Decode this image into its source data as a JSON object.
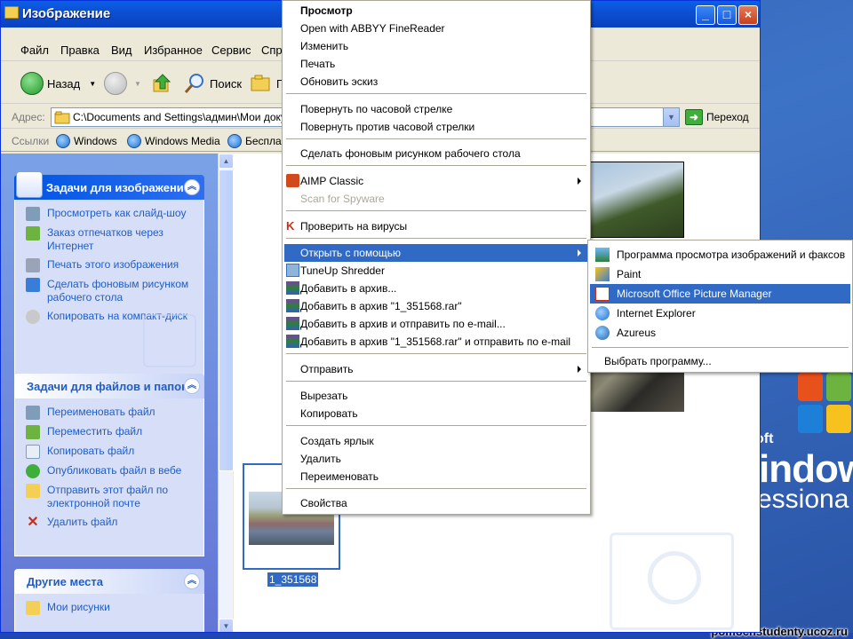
{
  "window": {
    "title": "Изображение",
    "menu": [
      "Файл",
      "Правка",
      "Вид",
      "Избранное",
      "Сервис",
      "Спра"
    ],
    "toolbar": {
      "back": "Назад",
      "search": "Поиск",
      "folders": "П"
    },
    "address": {
      "label": "Адрес:",
      "value": "C:\\Documents and Settings\\админ\\Мои доку",
      "go": "Переход"
    },
    "links": {
      "label": "Ссылки",
      "items": [
        "Windows",
        "Windows Media",
        "Беспла"
      ]
    }
  },
  "leftpane": {
    "image_tasks": {
      "title": "Задачи для изображени",
      "items": [
        "Просмотреть как слайд-шоу",
        "Заказ отпечатков через Интернет",
        "Печать этого изображения",
        "Сделать фоновым рисунком рабочего стола",
        "Копировать на компакт-диск"
      ]
    },
    "file_tasks": {
      "title": "Задачи для файлов и папок",
      "items": [
        "Переименовать файл",
        "Переместить файл",
        "Копировать файл",
        "Опубликовать файл в вебе",
        "Отправить этот файл по электронной почте",
        "Удалить файл"
      ]
    },
    "other_places": {
      "title": "Другие места",
      "items": [
        "Мои рисунки"
      ]
    }
  },
  "content": {
    "selected_file": "1_351568"
  },
  "context_menu": {
    "items": [
      {
        "label": "Просмотр",
        "bold": true
      },
      {
        "label": "Open with ABBYY FineReader"
      },
      {
        "label": "Изменить"
      },
      {
        "label": "Печать"
      },
      {
        "label": "Обновить эскиз"
      },
      {
        "label": "Повернуть по часовой стрелке"
      },
      {
        "label": "Повернуть против часовой стрелки"
      },
      {
        "label": "Сделать фоновым рисунком рабочего стола"
      },
      {
        "label": "AIMP Classic"
      },
      {
        "label": "Scan for Spyware",
        "disabled": true
      },
      {
        "label": "Проверить на вирусы"
      },
      {
        "label": "Открыть с помощью",
        "highlighted": true
      },
      {
        "label": "TuneUp Shredder"
      },
      {
        "label": "Добавить в архив..."
      },
      {
        "label": "Добавить в архив \"1_351568.rar\""
      },
      {
        "label": "Добавить в архив и отправить по e-mail..."
      },
      {
        "label": "Добавить в архив \"1_351568.rar\" и отправить по e-mail"
      },
      {
        "label": "Отправить"
      },
      {
        "label": "Вырезать"
      },
      {
        "label": "Копировать"
      },
      {
        "label": "Создать ярлык"
      },
      {
        "label": "Удалить"
      },
      {
        "label": "Переименовать"
      },
      {
        "label": "Свойства"
      }
    ]
  },
  "submenu": {
    "items": [
      {
        "label": "Программа просмотра изображений и факсов"
      },
      {
        "label": "Paint"
      },
      {
        "label": "Microsoft Office Picture Manager",
        "highlighted": true
      },
      {
        "label": "Internet Explorer"
      },
      {
        "label": "Azureus"
      },
      {
        "label": "Выбрать программу..."
      }
    ]
  },
  "desktop": {
    "os_logo": {
      "prefix": "oft",
      "name": "indow",
      "edition": "essiona"
    },
    "watermark": "pomochstudenty.ucoz.ru"
  },
  "colors": {
    "highlight": "#316ac5",
    "titlebar": "#0a5fe6",
    "taskpane": "#7ba2e7"
  }
}
